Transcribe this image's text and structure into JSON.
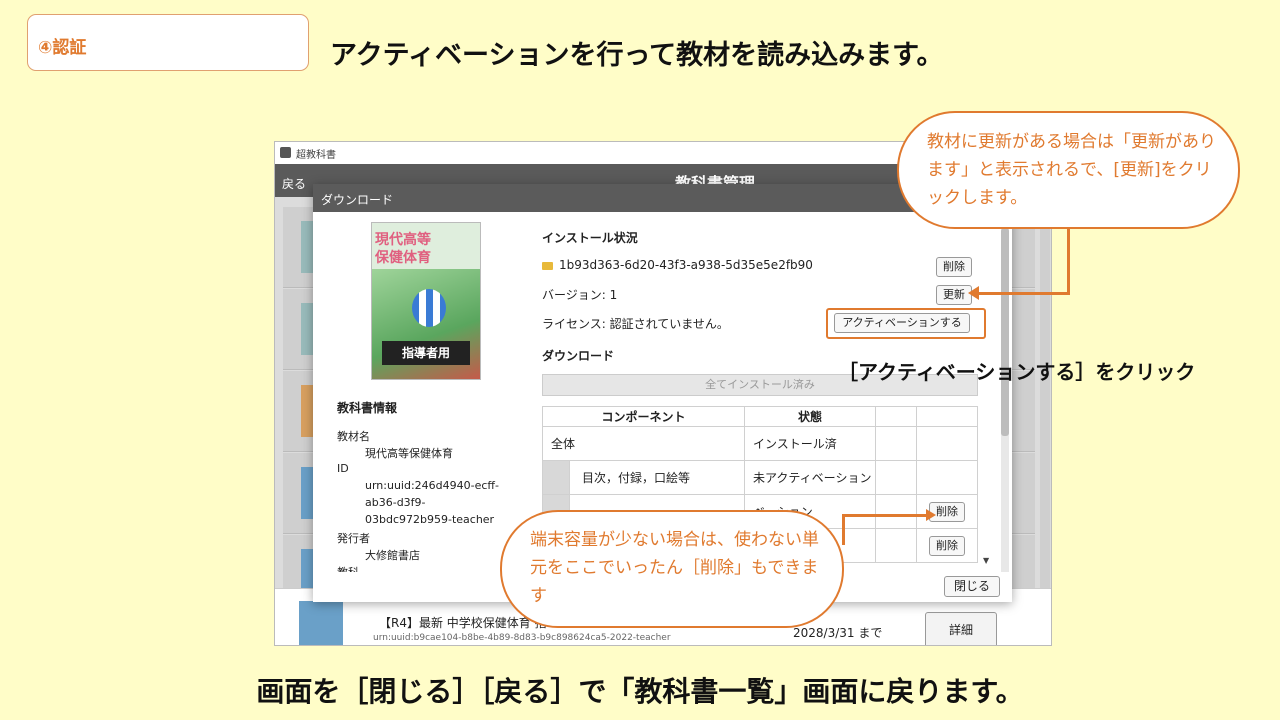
{
  "step_badge": "④認証",
  "headline": "アクティベーションを行って教材を読み込みます。",
  "footer": "画面を［閉じる］［戻る］で「教科書一覧」画面に戻ります。",
  "app": {
    "window_title": "超教科書",
    "back": "戻る",
    "header_title": "教科書管理",
    "bottom_item": {
      "title": "【R4】最新 中学校保健体育 指",
      "id": "urn:uuid:b9cae104-b8be-4b89-8d83-b9c898624ca5-2022-teacher",
      "date": "2028/3/31 まで",
      "detail_button": "詳細"
    }
  },
  "dialog": {
    "title": "ダウンロード",
    "cover": {
      "line1": "現代高等",
      "line2": "保健体育",
      "tag": "指導者用"
    },
    "info": {
      "heading": "教科書情報",
      "name_label": "教材名",
      "name_value": "現代高等保健体育",
      "id_label": "ID",
      "id_line1": "urn:uuid:246d4940-ecff-",
      "id_line2": "ab36-d3f9-",
      "id_line3": "03bdc972b959-teacher",
      "publisher_label": "発行者",
      "publisher_value": "大修館書店",
      "cut_label": "教科"
    },
    "install": {
      "heading": "インストール状況",
      "folder_id": "1b93d363-6d20-43f3-a938-5d35e5e2fb90",
      "delete_button": "削除",
      "version": "バージョン: 1",
      "update_button": "更新",
      "license": "ライセンス: 認証されていません。",
      "activate_button": "アクティベーションする"
    },
    "download": {
      "heading": "ダウンロード",
      "all_installed": "全てインストール済み"
    },
    "table": {
      "col_component": "コンポーネント",
      "col_status": "状態",
      "rows": [
        {
          "name": "全体",
          "status": "インストール済"
        },
        {
          "name": "目次，付録，口絵等",
          "status": "未アクティベーション"
        },
        {
          "name": "",
          "status": "ベーション",
          "button": "削除"
        },
        {
          "name": "",
          "status": "ション",
          "button": "削除"
        }
      ]
    },
    "close_button": "閉じる"
  },
  "callout_update": "教材に更新がある場合は「更新があります」と表示されるで、[更新]をクリックします。",
  "callout_delete": "端末容量が少ない場合は、使わない単元をここでいったん［削除」もできます",
  "activate_note": "［アクティベーションする］をクリック"
}
